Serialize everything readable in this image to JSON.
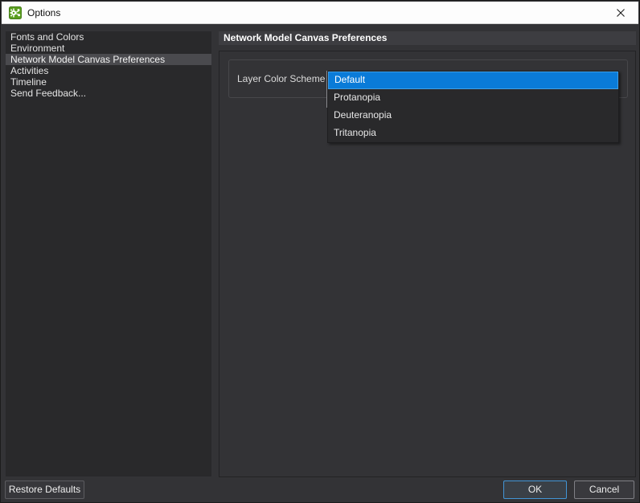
{
  "window": {
    "title": "Options",
    "icons": {
      "app": "app-logo-icon",
      "close": "close-icon"
    }
  },
  "colors": {
    "titlebar_bg": "#fdfdfd",
    "dialog_bg": "#333336",
    "sidebar_bg": "#29292b",
    "sidebar_selected_bg": "#4a4a4e",
    "header_bg": "#3d3d41",
    "selection_blue": "#0a7bd8",
    "selection_blue_border": "#3d9fe8",
    "ok_button_border": "#4295d6",
    "app_icon_green": "#5a9e1f"
  },
  "sidebar": {
    "items": [
      {
        "label": "Fonts and Colors",
        "selected": false
      },
      {
        "label": "Environment",
        "selected": false
      },
      {
        "label": "Network Model Canvas Preferences",
        "selected": true
      },
      {
        "label": "Activities",
        "selected": false
      },
      {
        "label": "Timeline",
        "selected": false
      },
      {
        "label": "Send Feedback...",
        "selected": false
      }
    ]
  },
  "main": {
    "header": "Network Model Canvas Preferences",
    "layer_color_scheme": {
      "label": "Layer Color Scheme",
      "selected_value": "Default",
      "options": [
        "Default",
        "Protanopia",
        "Deuteranopia",
        "Tritanopia"
      ]
    }
  },
  "footer": {
    "restore_defaults": "Restore Defaults",
    "ok": "OK",
    "cancel": "Cancel"
  }
}
